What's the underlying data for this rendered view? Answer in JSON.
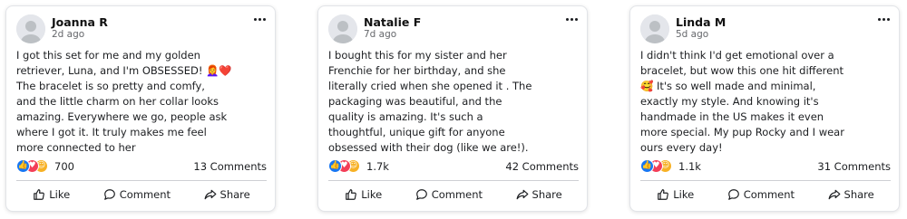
{
  "actions": {
    "like": "Like",
    "comment": "Comment",
    "share": "Share"
  },
  "icons": {
    "avatar": "default-avatar-icon",
    "more": "more-options-icon",
    "reactions": [
      "like-reaction-icon",
      "love-reaction-icon",
      "care-reaction-icon"
    ],
    "like": "thumbs-up-icon",
    "comment": "comment-bubble-icon",
    "share": "share-arrow-icon"
  },
  "colors": {
    "like": "#1877f2",
    "love": "#f33e58",
    "care": "#f7b125",
    "muted": "#65676b"
  },
  "posts": [
    {
      "author": "Joanna R",
      "time": "2d ago",
      "lines": [
        "I got this set for me and my golden",
        "retriever, Luna, and I'm OBSESSED! 👩‍🦰❤️",
        "The bracelet is so pretty and comfy,",
        "and the little charm on her collar looks",
        "amazing. Everywhere we go, people ask",
        "where I got it. It truly makes me feel",
        "more connected to her"
      ],
      "reactions": "700",
      "comments": "13 Comments"
    },
    {
      "author": "Natalie F",
      "time": "7d ago",
      "lines": [
        "I bought this for my sister and her",
        "Frenchie for her birthday, and she",
        "literally cried when she opened it  . The",
        "packaging was beautiful, and the",
        "quality is amazing. It's such a",
        "thoughtful, unique gift for anyone",
        "obsessed with their dog (like we are!)."
      ],
      "reactions": "1.7k",
      "comments": "42 Comments"
    },
    {
      "author": "Linda M",
      "time": "5d ago",
      "lines": [
        "I didn't think I'd get emotional over a",
        "bracelet, but wow this one hit different",
        "🥰 It's so well made and minimal,",
        "exactly my style. And knowing it's",
        "handmade in the US makes it even",
        "more special. My pup Rocky and I wear",
        "ours every day!"
      ],
      "reactions": "1.1k",
      "comments": "31 Comments"
    }
  ]
}
